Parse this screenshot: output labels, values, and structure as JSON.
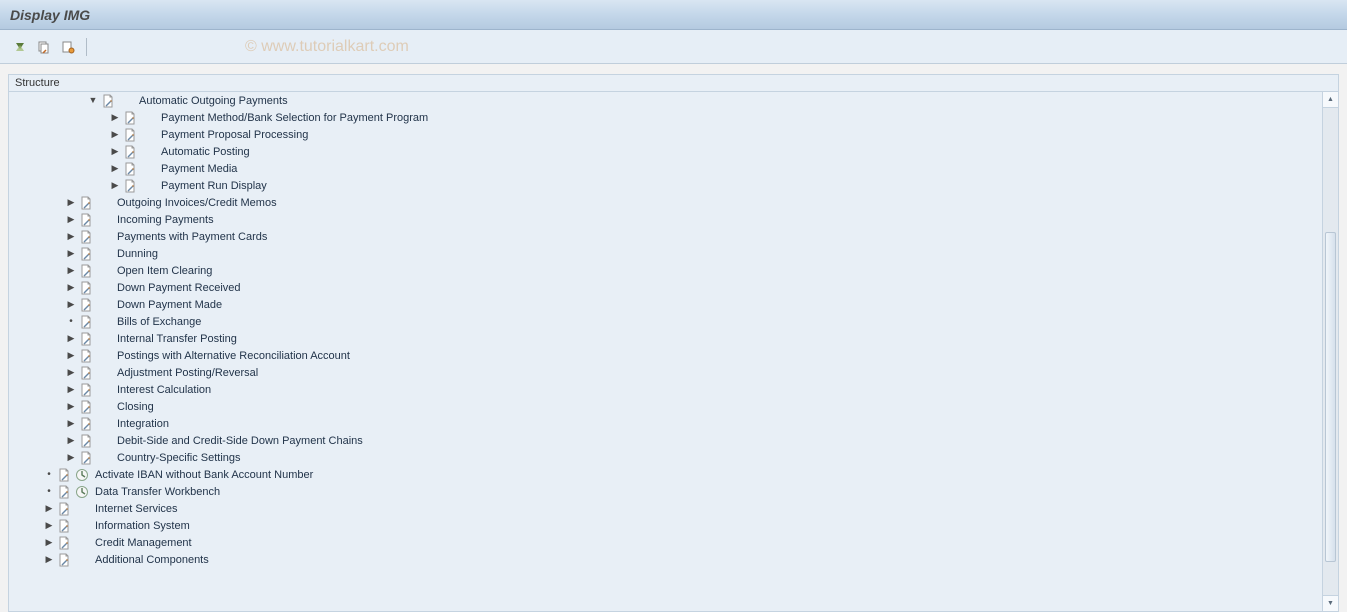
{
  "title": "Display IMG",
  "watermark": "© www.tutorialkart.com",
  "structure_header": "Structure",
  "tree": [
    {
      "indent": 78,
      "expander": "down",
      "exec": false,
      "label": "Automatic Outgoing Payments"
    },
    {
      "indent": 100,
      "expander": "right",
      "exec": false,
      "label": "Payment Method/Bank Selection for Payment Program"
    },
    {
      "indent": 100,
      "expander": "right",
      "exec": false,
      "label": "Payment Proposal Processing"
    },
    {
      "indent": 100,
      "expander": "right",
      "exec": false,
      "label": "Automatic Posting"
    },
    {
      "indent": 100,
      "expander": "right",
      "exec": false,
      "label": "Payment Media"
    },
    {
      "indent": 100,
      "expander": "right",
      "exec": false,
      "label": "Payment Run Display"
    },
    {
      "indent": 56,
      "expander": "right",
      "exec": false,
      "label": "Outgoing Invoices/Credit Memos"
    },
    {
      "indent": 56,
      "expander": "right",
      "exec": false,
      "label": "Incoming Payments"
    },
    {
      "indent": 56,
      "expander": "right",
      "exec": false,
      "label": "Payments with Payment Cards"
    },
    {
      "indent": 56,
      "expander": "right",
      "exec": false,
      "label": "Dunning"
    },
    {
      "indent": 56,
      "expander": "right",
      "exec": false,
      "label": "Open Item Clearing"
    },
    {
      "indent": 56,
      "expander": "right",
      "exec": false,
      "label": "Down Payment Received"
    },
    {
      "indent": 56,
      "expander": "right",
      "exec": false,
      "label": "Down Payment Made"
    },
    {
      "indent": 56,
      "expander": "dot",
      "exec": false,
      "label": "Bills of Exchange"
    },
    {
      "indent": 56,
      "expander": "right",
      "exec": false,
      "label": "Internal Transfer Posting"
    },
    {
      "indent": 56,
      "expander": "right",
      "exec": false,
      "label": "Postings with Alternative Reconciliation Account"
    },
    {
      "indent": 56,
      "expander": "right",
      "exec": false,
      "label": "Adjustment Posting/Reversal"
    },
    {
      "indent": 56,
      "expander": "right",
      "exec": false,
      "label": "Interest Calculation"
    },
    {
      "indent": 56,
      "expander": "right",
      "exec": false,
      "label": "Closing"
    },
    {
      "indent": 56,
      "expander": "right",
      "exec": false,
      "label": "Integration"
    },
    {
      "indent": 56,
      "expander": "right",
      "exec": false,
      "label": "Debit-Side and Credit-Side Down Payment Chains"
    },
    {
      "indent": 56,
      "expander": "right",
      "exec": false,
      "label": "Country-Specific Settings"
    },
    {
      "indent": 34,
      "expander": "dot",
      "exec": true,
      "label": "Activate IBAN without Bank Account Number"
    },
    {
      "indent": 34,
      "expander": "dot",
      "exec": true,
      "label": "Data Transfer Workbench"
    },
    {
      "indent": 34,
      "expander": "right",
      "exec": false,
      "label": "Internet Services"
    },
    {
      "indent": 34,
      "expander": "right",
      "exec": false,
      "label": "Information System"
    },
    {
      "indent": 34,
      "expander": "right",
      "exec": false,
      "label": "Credit Management"
    },
    {
      "indent": 34,
      "expander": "right",
      "exec": false,
      "label": "Additional Components"
    }
  ]
}
